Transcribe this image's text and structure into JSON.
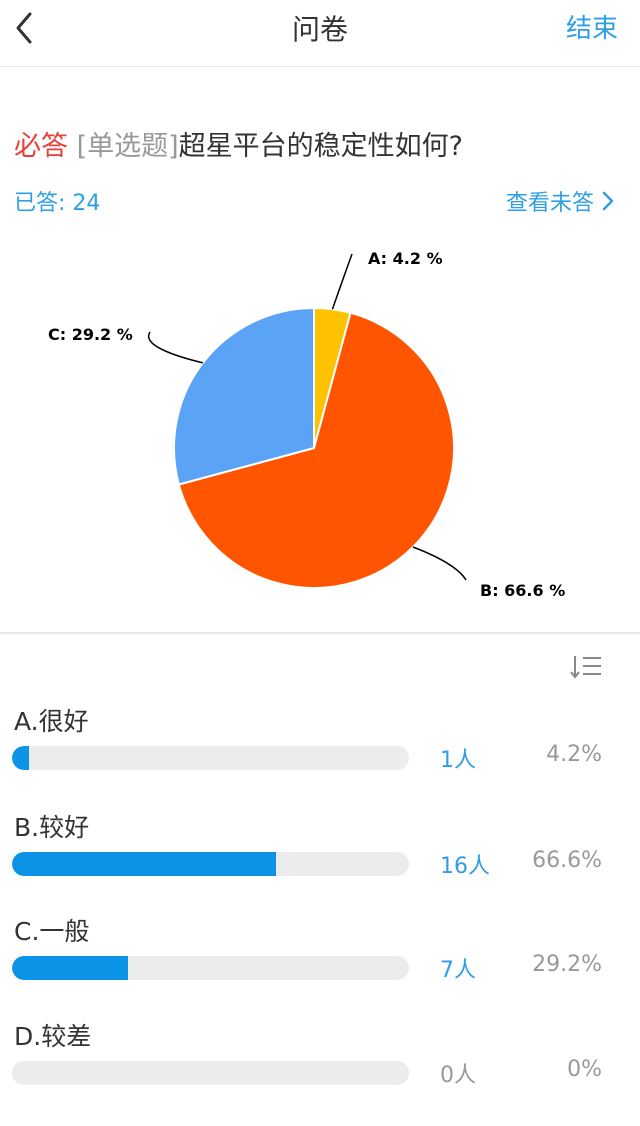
{
  "nav": {
    "title": "问卷",
    "end_label": "结束"
  },
  "question": {
    "required_label": "必答",
    "type_label": "[单选题]",
    "text": "超星平台的稳定性如何?"
  },
  "stats": {
    "answered_label": "已答: 24",
    "view_unanswered_label": "查看未答"
  },
  "chart_data": {
    "type": "pie",
    "slices": [
      {
        "label": "A: 4.2 %",
        "value": 4.2,
        "color": "#ffc200"
      },
      {
        "label": "B: 66.6 %",
        "value": 66.6,
        "color": "#ff5500"
      },
      {
        "label": "C: 29.2 %",
        "value": 29.2,
        "color": "#5ba3f5"
      }
    ]
  },
  "options": [
    {
      "label": "A.很好",
      "count": "1人",
      "percent": "4.2%",
      "fraction": 0.042
    },
    {
      "label": "B.较好",
      "count": "16人",
      "percent": "66.6%",
      "fraction": 0.666
    },
    {
      "label": "C.一般",
      "count": "7人",
      "percent": "29.2%",
      "fraction": 0.292
    },
    {
      "label": "D.较差",
      "count": "0人",
      "percent": "0%",
      "fraction": 0
    }
  ],
  "colors": {
    "accent": "#2e9fe6",
    "bar_fill": "#0b93e6",
    "required": "#e5423a"
  },
  "icons": {
    "back": "chevron-left-icon",
    "more": "chevron-right-icon",
    "sort": "sort-icon"
  }
}
